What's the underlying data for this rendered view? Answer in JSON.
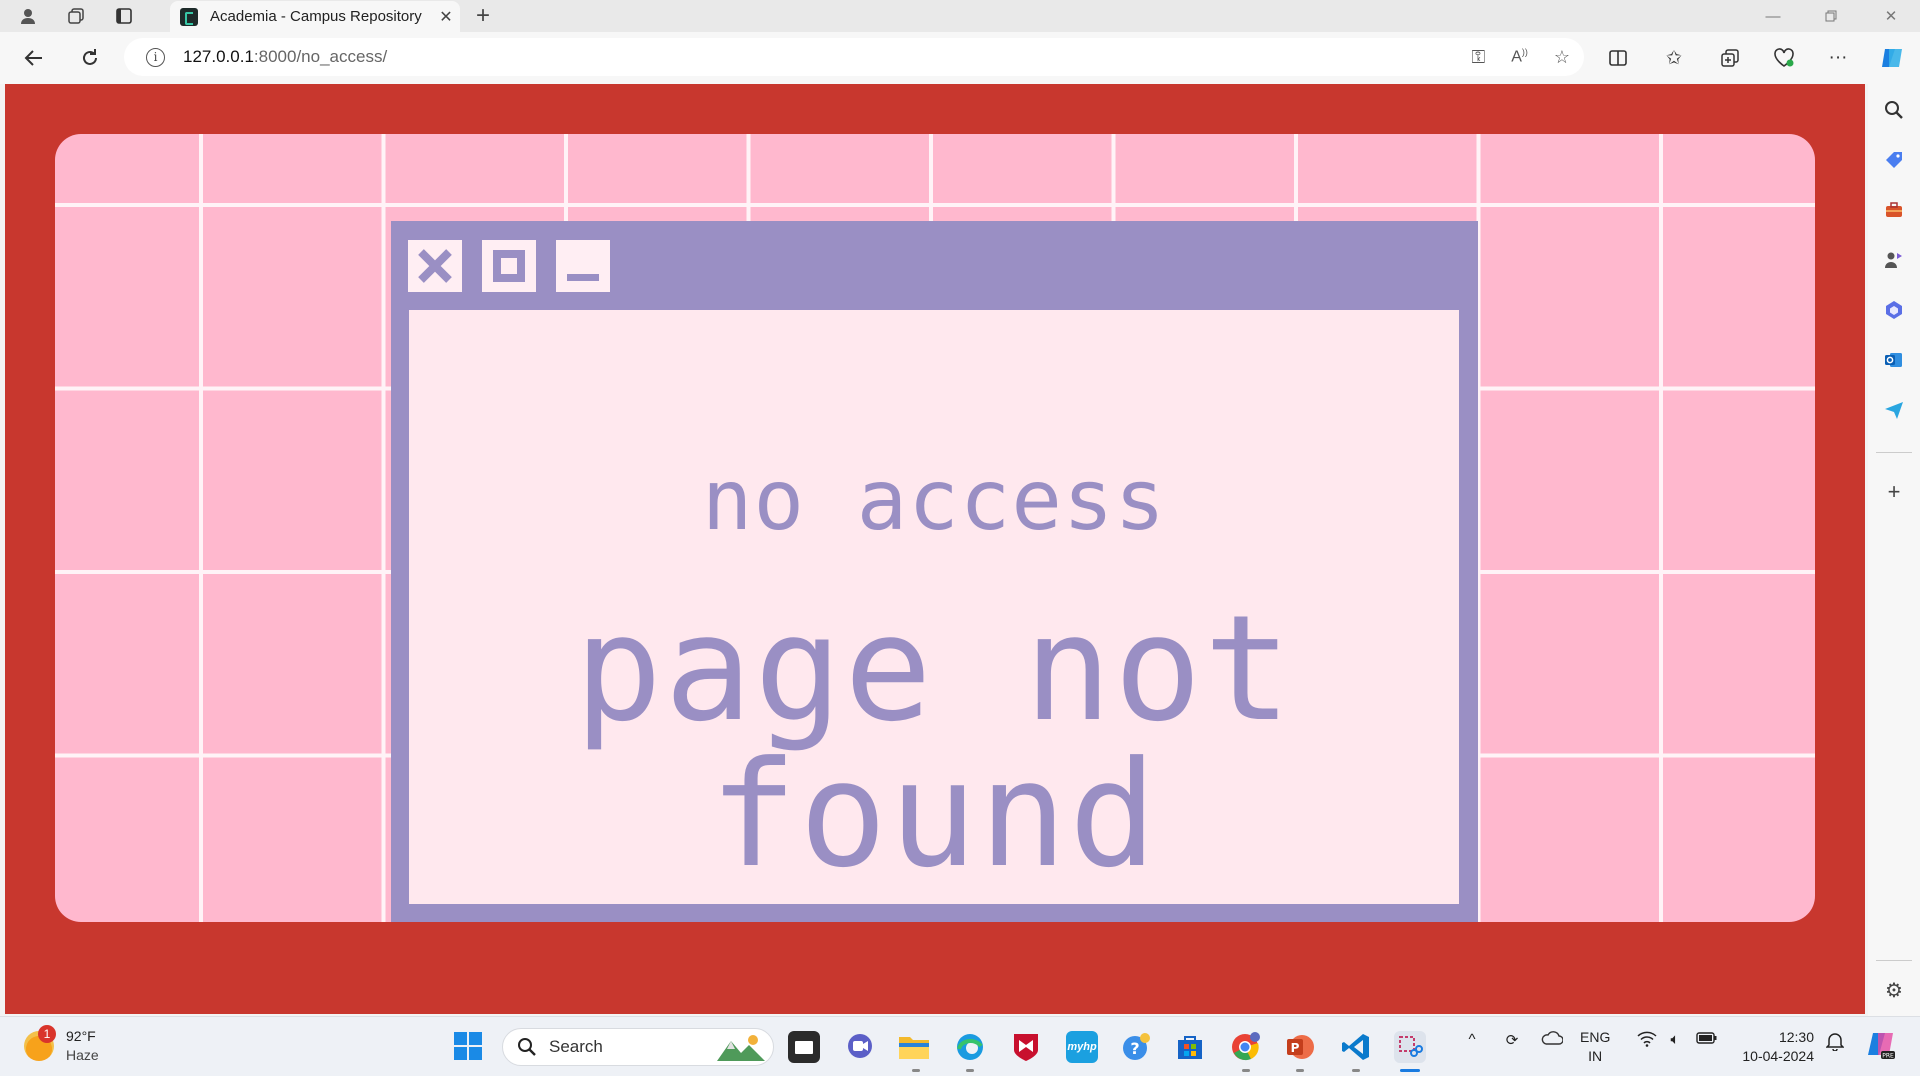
{
  "browser": {
    "tab_title": "Academia - Campus Repository",
    "url_host": "127.0.0.1",
    "url_path": ":8000/no_access/"
  },
  "page": {
    "message_primary": "no access",
    "message_secondary": "page not found",
    "colors": {
      "background": "#c8372e",
      "grid_pink": "#ffb8ce",
      "grid_lines": "#fff3f7",
      "window_frame": "#9a8fc4",
      "window_body": "#ffe8ee"
    },
    "window_buttons": [
      "close-icon",
      "maximize-icon",
      "minimize-icon"
    ]
  },
  "taskbar": {
    "weather_temp": "92°F",
    "weather_condition": "Haze",
    "weather_badge": "1",
    "search_label": "Search",
    "lang_line1": "ENG",
    "lang_line2": "IN",
    "time": "12:30",
    "date": "10-04-2024"
  }
}
